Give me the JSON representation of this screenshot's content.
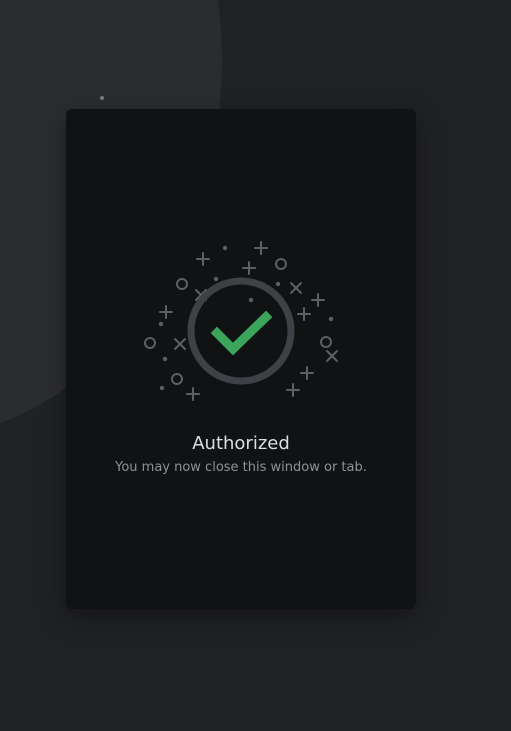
{
  "auth": {
    "title": "Authorized",
    "subtitle": "You may now close this window or tab."
  },
  "colors": {
    "check": "#3ba55c",
    "ring": "#3f4147",
    "sparkle": "#5c5f66"
  },
  "icons": {
    "status": "check-circle-icon",
    "decoration": "sparkle-icon"
  }
}
